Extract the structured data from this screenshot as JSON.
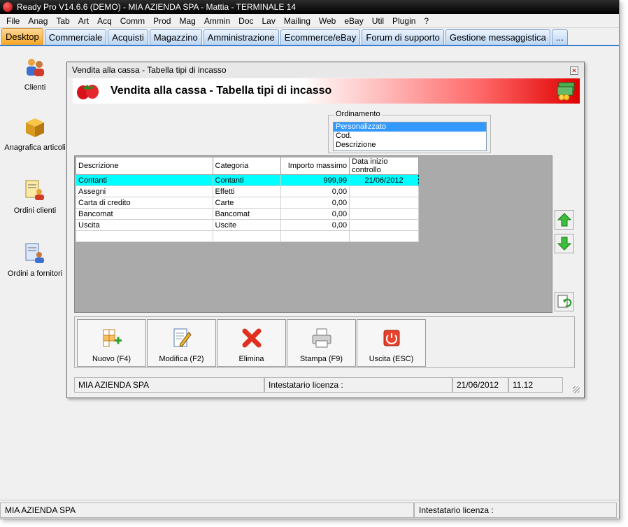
{
  "window": {
    "title": "Ready Pro V14.6.6 (DEMO)  - MIA AZIENDA SPA - Mattia - TERMINALE 14"
  },
  "menu": [
    "File",
    "Anag",
    "Tab",
    "Art",
    "Acq",
    "Comm",
    "Prod",
    "Mag",
    "Ammin",
    "Doc",
    "Lav",
    "Mailing",
    "Web",
    "eBay",
    "Util",
    "Plugin",
    "?"
  ],
  "tabs": [
    "Desktop",
    "Commerciale",
    "Acquisti",
    "Magazzino",
    "Amministrazione",
    "Ecommerce/eBay",
    "Forum di supporto",
    "Gestione messaggistica",
    "..."
  ],
  "desktop_icons": [
    {
      "label": "Clienti",
      "icon": "clients-icon"
    },
    {
      "label": "Anagrafica articoli",
      "icon": "box-icon"
    },
    {
      "label": "Ordini clienti",
      "icon": "client-orders-icon"
    },
    {
      "label": "Ordini a fornitori",
      "icon": "supplier-orders-icon"
    }
  ],
  "dialog": {
    "title": "Vendita alla cassa - Tabella tipi di incasso",
    "banner_title": "Vendita alla cassa - Tabella tipi di incasso",
    "ordering": {
      "legend": "Ordinamento",
      "options": [
        "Personalizzato",
        "Cod.",
        "Descrizione"
      ],
      "selected": "Personalizzato"
    },
    "grid": {
      "columns": [
        "Descrizione",
        "Categoria",
        "Importo massimo",
        "Data inizio controllo"
      ],
      "rows": [
        [
          "Contanti",
          "Contanti",
          "999,99",
          "21/06/2012"
        ],
        [
          "Assegni",
          "Effetti",
          "0,00",
          ""
        ],
        [
          "Carta di credito",
          "Carte",
          "0,00",
          ""
        ],
        [
          "Bancomat",
          "Bancomat",
          "0,00",
          ""
        ],
        [
          "Uscita",
          "Uscite",
          "0,00",
          ""
        ],
        [
          "",
          "",
          "",
          ""
        ]
      ]
    },
    "buttons": {
      "new": "Nuovo (F4)",
      "edit": "Modifica (F2)",
      "delete": "Elimina",
      "print": "Stampa (F9)",
      "exit": "Uscita (ESC)"
    },
    "status": {
      "company": "MIA AZIENDA SPA",
      "license": "Intestatario licenza :",
      "date": "21/06/2012",
      "time": "11.12"
    }
  },
  "status_bar": {
    "company": "MIA AZIENDA SPA",
    "license": "Intestatario licenza :"
  },
  "colors": {
    "active_tab": "#f5a623",
    "selected_row": "#00ffff",
    "banner_red": "#e00000",
    "list_selection": "#3399ff"
  }
}
